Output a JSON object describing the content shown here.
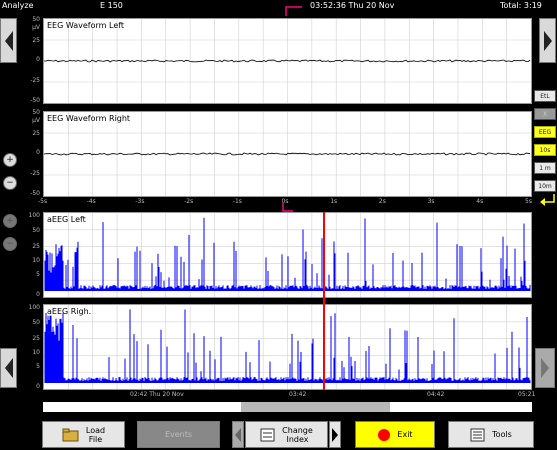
{
  "topbar": {
    "mode": "Analyze",
    "device": "E 150",
    "clock": "03:52:36 Thu 20 Nov",
    "total": "Total: 3:19"
  },
  "eeg_left": {
    "title": "EEG Waveform Left",
    "yticks": [
      "50",
      "μV",
      "25",
      "0",
      "-25",
      "-50"
    ]
  },
  "eeg_right": {
    "title": "EEG Waveform Right",
    "yticks": [
      "50",
      "μV",
      "25",
      "0",
      "-25",
      "-50"
    ]
  },
  "eeg_xticks": [
    "-5s",
    "-4s",
    "-3s",
    "-2s",
    "-1s",
    "0s",
    "1s",
    "2s",
    "3s",
    "4s",
    "5s"
  ],
  "aeeg_left": {
    "title": "aEEG Left",
    "yticks": [
      "100",
      "50",
      "25",
      "10",
      "5",
      "0"
    ]
  },
  "aeeg_right": {
    "title": "aEEG Righ.",
    "yticks": [
      "100",
      "50",
      "25",
      "10",
      "5",
      "0"
    ]
  },
  "aeeg_xticks": [
    "02:42 Thu 20 Nov",
    "03:42",
    "04:42",
    "05:21"
  ],
  "side_buttons": [
    "EtL",
    "X",
    "EEG",
    "10s",
    "1 m",
    "10m"
  ],
  "footer": {
    "load_file": [
      "Load",
      "File"
    ],
    "events": "Events",
    "change_index": [
      "Change",
      "Index"
    ],
    "exit": "Exit",
    "tools": "Tools"
  },
  "colors": {
    "trace": "#0000ff",
    "cursor": "#ff0000",
    "accent": "#ffff00",
    "marker": "#ff0080"
  }
}
